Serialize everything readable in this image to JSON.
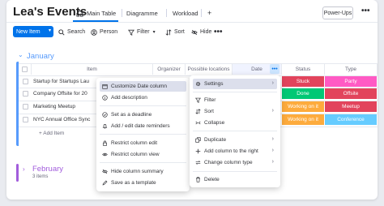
{
  "header": {
    "board_title": "Lea's Events",
    "tabs": [
      {
        "label": "Main Table"
      },
      {
        "label": "Diagramme"
      },
      {
        "label": "Workload"
      }
    ],
    "add_tab": "+",
    "powerups": "Power-Ups",
    "more": "•••"
  },
  "toolbar": {
    "new_item": "New Item",
    "new_item_caret": "▾",
    "search": "Search",
    "person": "Person",
    "filter": "Filter",
    "filter_caret": "▾",
    "sort": "Sort",
    "hide": "Hide",
    "more": "•••"
  },
  "groups": [
    {
      "title": "January",
      "color": "#579bfc",
      "columns": [
        "Item",
        "Organizer",
        "Possible locations",
        "Date",
        "Status",
        "Type"
      ],
      "date_more": "•••",
      "rows": [
        {
          "name": "Startup for Startups Lau",
          "status": "Stuck",
          "status_color": "#e2445c",
          "type": "Party",
          "type_color": "#ff5ac4"
        },
        {
          "name": "Company Offsite for 20",
          "status": "Done",
          "status_color": "#00c875",
          "type": "Offsite",
          "type_color": "#e2445c"
        },
        {
          "name": "Marketing Meetup",
          "status": "Working on it",
          "status_color": "#fdab3d",
          "type": "Meetup",
          "type_color": "#e2445c"
        },
        {
          "name": "NYC Annual Office Sync",
          "status": "Working on it",
          "status_color": "#fdab3d",
          "type": "Conference",
          "type_color": "#66ccff"
        }
      ],
      "add_item": "+ Add Item"
    },
    {
      "title": "February",
      "color": "#a25ddc",
      "count": "3 items"
    }
  ],
  "column_menu": {
    "items": [
      {
        "label": "Customize Date column",
        "icon": "calendar-icon"
      },
      {
        "label": "Add description",
        "icon": "info-icon"
      },
      {
        "label": "Set as a deadline",
        "icon": "check-circle-icon"
      },
      {
        "label": "Add / edit date reminders",
        "icon": "bell-icon"
      },
      {
        "label": "Restrict column edit",
        "icon": "lock-icon"
      },
      {
        "label": "Restrict column view",
        "icon": "eye-icon"
      },
      {
        "label": "Hide column summary",
        "icon": "hide-eye-icon"
      },
      {
        "label": "Save as a template",
        "icon": "pencil-icon"
      }
    ]
  },
  "context_menu": {
    "items": [
      {
        "label": "Settings",
        "icon": "gear-icon",
        "submenu": true
      },
      {
        "label": "Filter",
        "icon": "filter-icon"
      },
      {
        "label": "Sort",
        "icon": "sort-icon",
        "submenu": true
      },
      {
        "label": "Collapse",
        "icon": "collapse-icon"
      },
      {
        "label": "Duplicate",
        "icon": "duplicate-icon",
        "submenu": true
      },
      {
        "label": "Add column to the right",
        "icon": "plus-icon",
        "submenu": true
      },
      {
        "label": "Change column type",
        "icon": "swap-icon",
        "submenu": true
      },
      {
        "label": "Delete",
        "icon": "trash-icon"
      }
    ],
    "arrow": "›"
  }
}
